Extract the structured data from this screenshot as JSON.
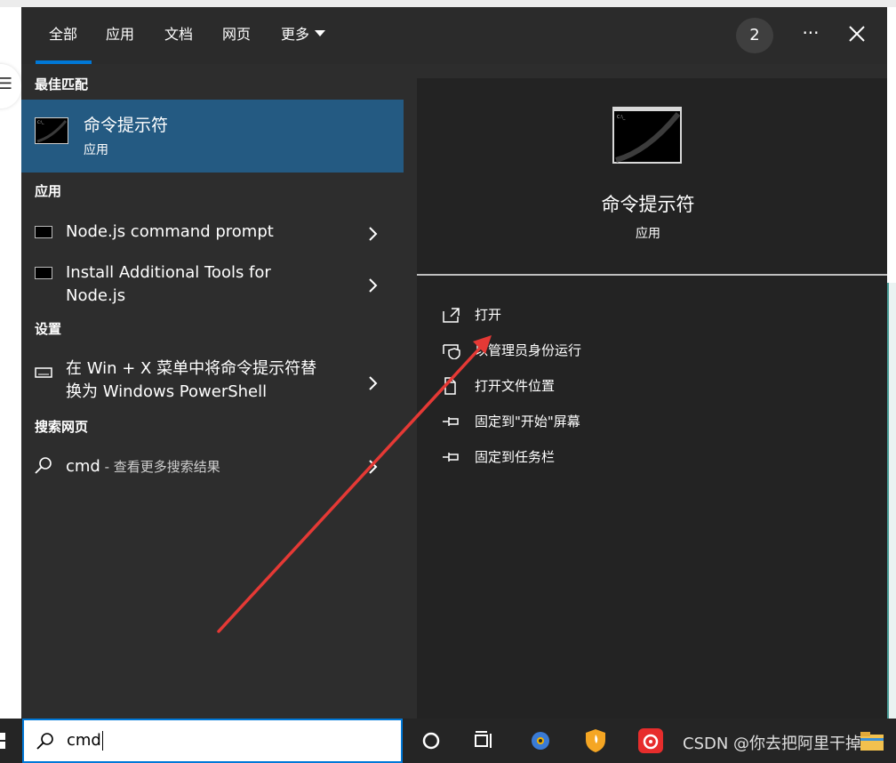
{
  "tabs": [
    {
      "label": "全部"
    },
    {
      "label": "应用"
    },
    {
      "label": "文档"
    },
    {
      "label": "网页"
    },
    {
      "label": "更多"
    }
  ],
  "header": {
    "badge": "2",
    "more_icon": "ellipsis-icon",
    "close_icon": "close-icon"
  },
  "left": {
    "best_match_heading": "最佳匹配",
    "best_match": {
      "title": "命令提示符",
      "subtitle": "应用"
    },
    "apps_heading": "应用",
    "apps": [
      {
        "label": "Node.js command prompt"
      },
      {
        "label_line1": "Install Additional Tools for",
        "label_line2": "Node.js"
      }
    ],
    "settings_heading": "设置",
    "settings": [
      {
        "label_line1": "在 Win + X 菜单中将命令提示符替",
        "label_line2": "换为 Windows PowerShell"
      }
    ],
    "web_heading": "搜索网页",
    "web": {
      "query": "cmd",
      "suffix": " - 查看更多搜索结果"
    }
  },
  "preview": {
    "title": "命令提示符",
    "subtitle": "应用",
    "actions": [
      {
        "label": "打开",
        "icon": "open-icon"
      },
      {
        "label": "以管理员身份运行",
        "icon": "shield-icon"
      },
      {
        "label": "打开文件位置",
        "icon": "file-location-icon"
      },
      {
        "label": "固定到\"开始\"屏幕",
        "icon": "pin-icon"
      },
      {
        "label": "固定到任务栏",
        "icon": "pin-icon"
      }
    ]
  },
  "taskbar": {
    "search_value": "cmd",
    "watermark": "CSDN @你去把阿里干掉"
  },
  "annotation": {
    "color": "#e53935"
  }
}
